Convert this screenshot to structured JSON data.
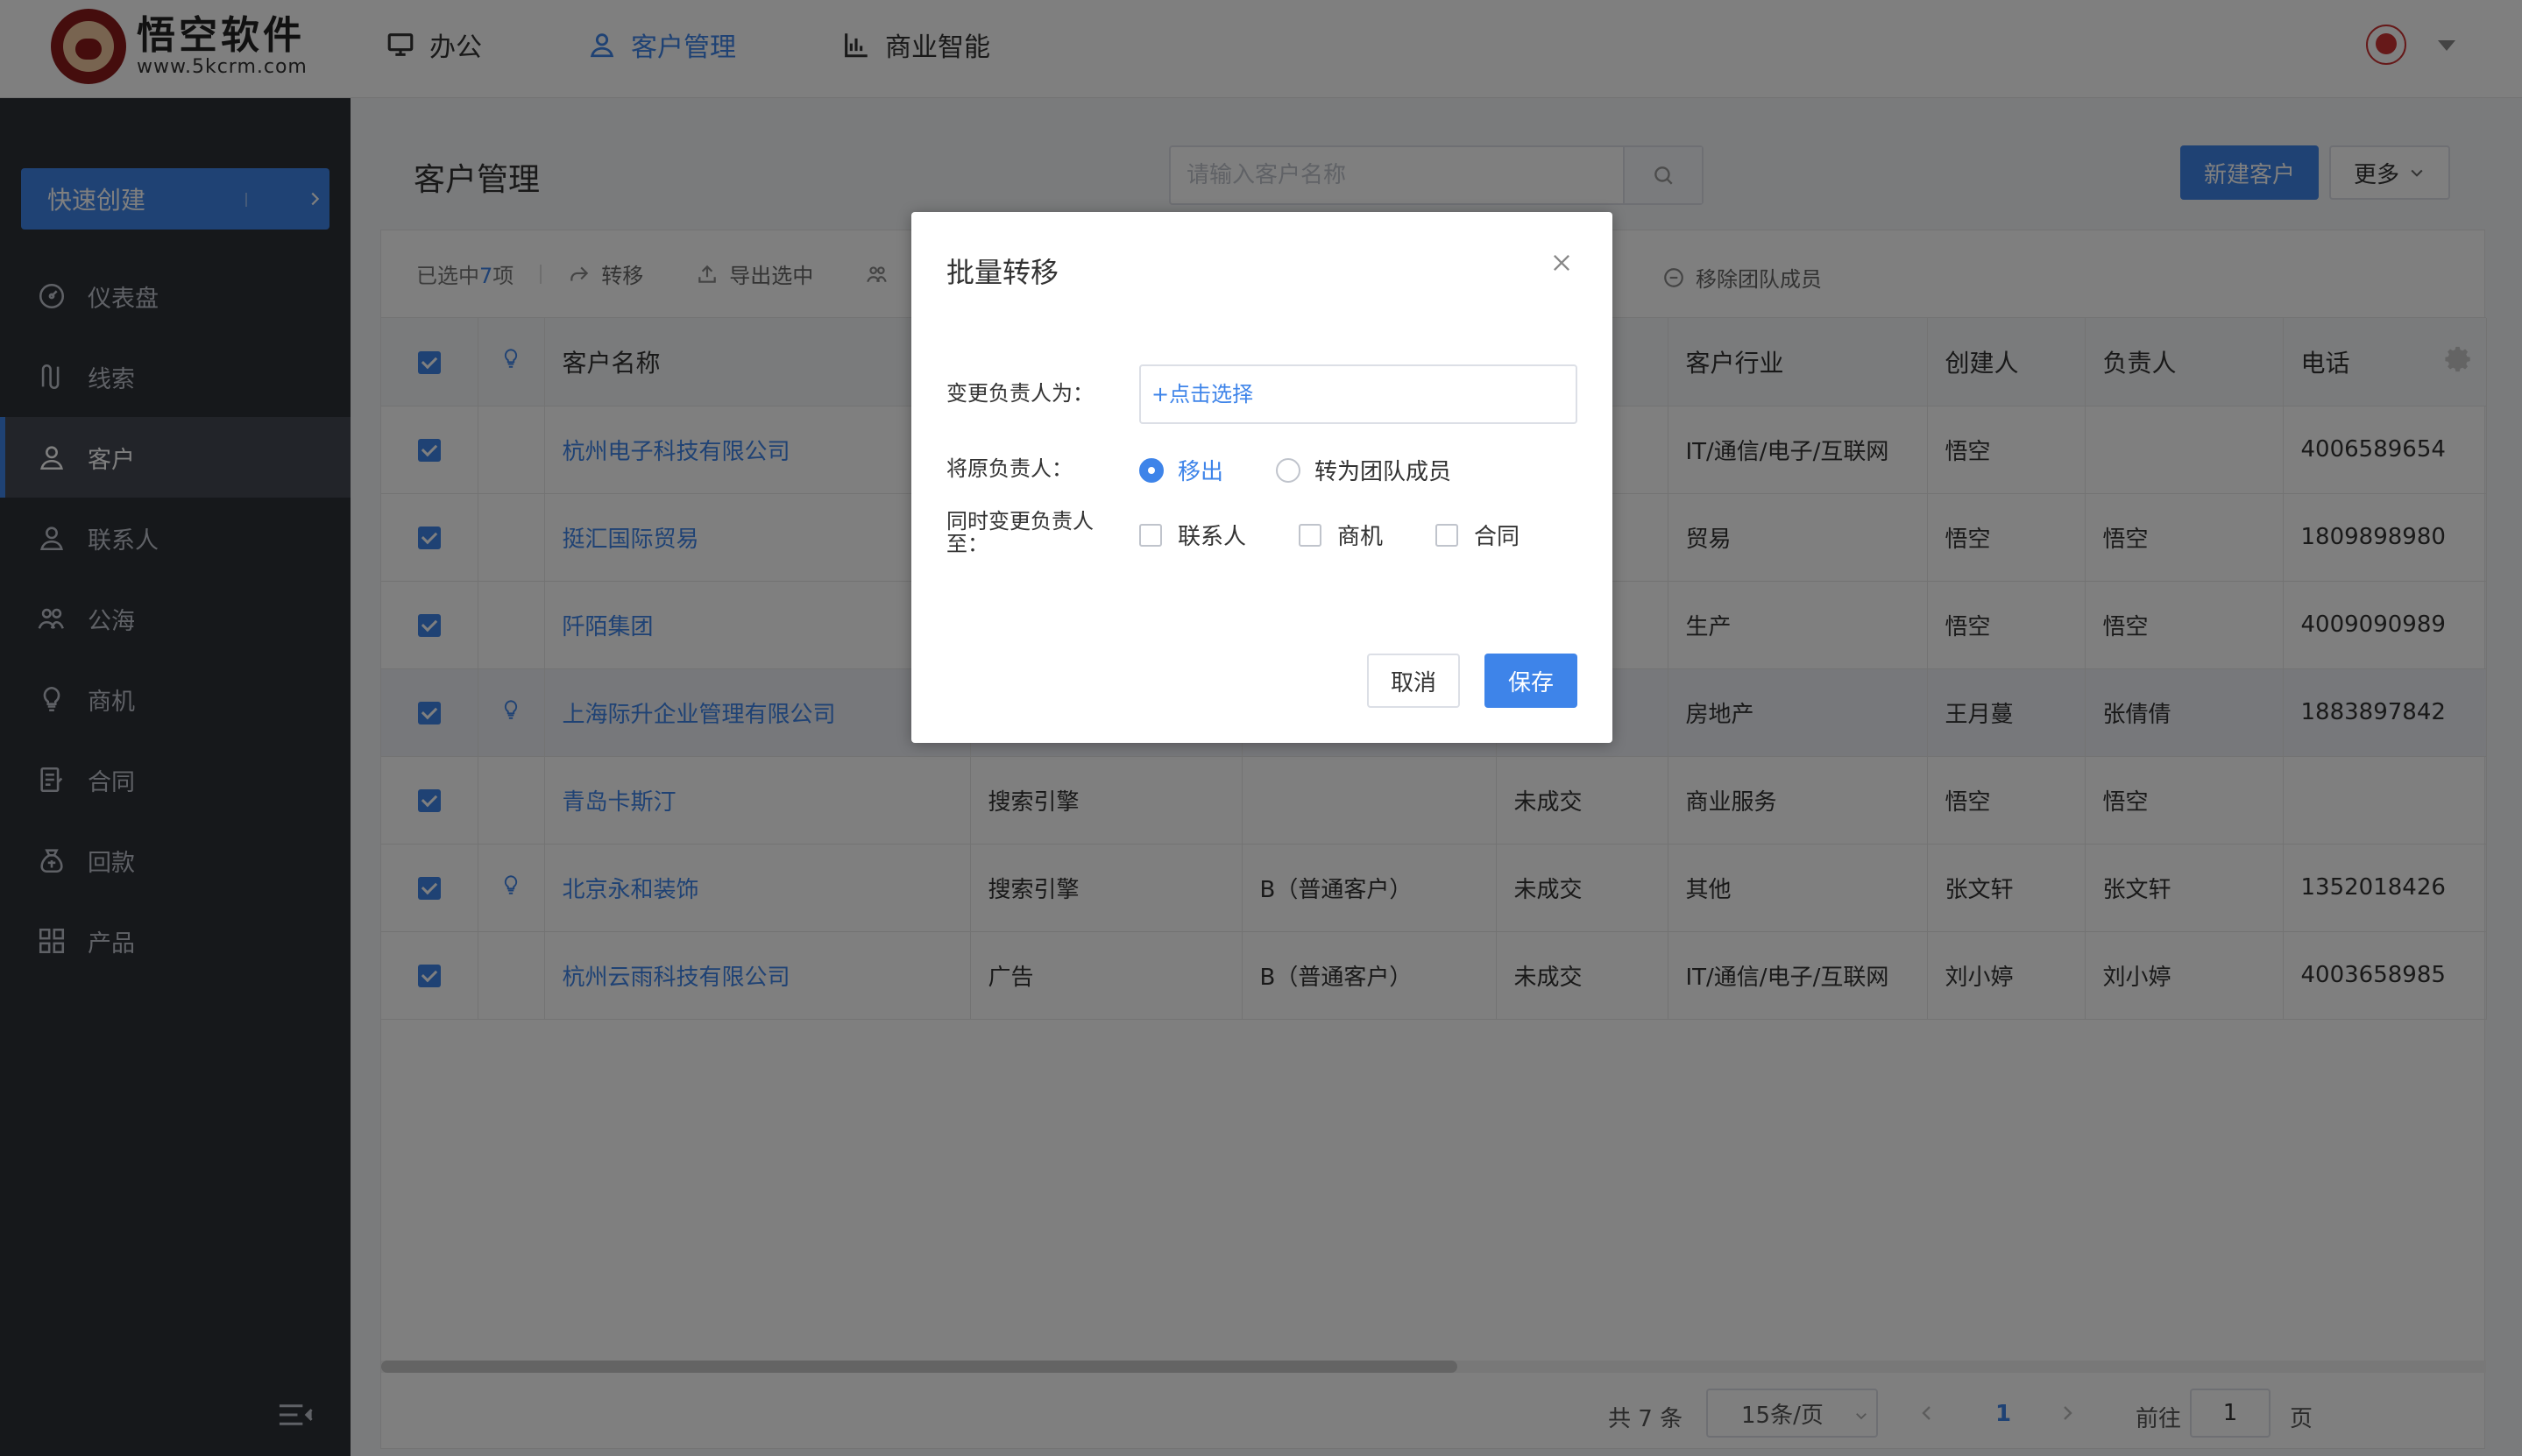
{
  "brand": {
    "title": "悟空软件",
    "subtitle": "www.5kcrm.com"
  },
  "topnav": [
    {
      "label": "办公",
      "icon": "monitor-icon"
    },
    {
      "label": "客户管理",
      "icon": "user-icon",
      "active": true
    },
    {
      "label": "商业智能",
      "icon": "bar-chart-icon"
    }
  ],
  "sidebar": {
    "quick_create": "快速创建",
    "items": [
      {
        "label": "仪表盘",
        "icon": "dashboard-icon"
      },
      {
        "label": "线索",
        "icon": "leads-icon"
      },
      {
        "label": "客户",
        "icon": "customer-icon",
        "active": true
      },
      {
        "label": "联系人",
        "icon": "contact-icon"
      },
      {
        "label": "公海",
        "icon": "pool-icon"
      },
      {
        "label": "商机",
        "icon": "bulb-icon"
      },
      {
        "label": "合同",
        "icon": "contract-icon"
      },
      {
        "label": "回款",
        "icon": "payment-icon"
      },
      {
        "label": "产品",
        "icon": "product-icon"
      }
    ]
  },
  "main": {
    "page_title": "客户管理",
    "search_placeholder": "请输入客户名称",
    "new_button": "新建客户",
    "more_button": "更多"
  },
  "toolbar": {
    "selected_prefix": "已选中",
    "selected_count": "7",
    "selected_suffix": "项",
    "transfer": "转移",
    "export": "导出选中",
    "remove_team": "移除团队成员"
  },
  "table": {
    "headers": {
      "name": "客户名称",
      "industry": "客户行业",
      "creator": "创建人",
      "owner": "负责人",
      "phone": "电话"
    },
    "rows": [
      {
        "name": "杭州电子科技有限公司",
        "source": "",
        "level": "",
        "status": "",
        "industry": "IT/通信/电子/互联网",
        "creator": "悟空",
        "owner": "",
        "phone": "4006589654",
        "bulb": false,
        "highlight": false
      },
      {
        "name": "挺汇国际贸易",
        "source": "",
        "level": "",
        "status": "",
        "industry": "贸易",
        "creator": "悟空",
        "owner": "悟空",
        "phone": "1809898980",
        "bulb": false,
        "highlight": false
      },
      {
        "name": "阡陌集团",
        "source": "",
        "level": "",
        "status": "",
        "industry": "生产",
        "creator": "悟空",
        "owner": "悟空",
        "phone": "4009090989",
        "bulb": false,
        "highlight": false
      },
      {
        "name": "上海际升企业管理有限公司",
        "source": "",
        "level": "",
        "status": "",
        "industry": "房地产",
        "creator": "王月蔓",
        "owner": "张倩倩",
        "phone": "1883897842",
        "bulb": true,
        "highlight": true
      },
      {
        "name": "青岛卡斯汀",
        "source": "搜索引擎",
        "level": "",
        "status": "未成交",
        "industry": "商业服务",
        "creator": "悟空",
        "owner": "悟空",
        "phone": "",
        "bulb": false,
        "highlight": false
      },
      {
        "name": "北京永和装饰",
        "source": "搜索引擎",
        "level": "B（普通客户）",
        "status": "未成交",
        "industry": "其他",
        "creator": "张文轩",
        "owner": "张文轩",
        "phone": "1352018426",
        "bulb": true,
        "highlight": false
      },
      {
        "name": "杭州云雨科技有限公司",
        "source": "广告",
        "level": "B（普通客户）",
        "status": "未成交",
        "industry": "IT/通信/电子/互联网",
        "creator": "刘小婷",
        "owner": "刘小婷",
        "phone": "4003658985",
        "bulb": false,
        "highlight": false
      }
    ]
  },
  "pager": {
    "total": "共 7 条",
    "page_size": "15条/页",
    "current_page": "1",
    "goto_label": "前往",
    "goto_value": "1",
    "goto_suffix": "页"
  },
  "dialog": {
    "title": "批量转移",
    "owner_label": "变更负责人为：",
    "owner_placeholder": "+点击选择",
    "original_label": "将原负责人：",
    "option_remove": "移出",
    "option_team": "转为团队成员",
    "also_label": "同时变更负责人至：",
    "chk_contact": "联系人",
    "chk_opportunity": "商机",
    "chk_contract": "合同",
    "cancel": "取消",
    "save": "保存"
  },
  "colors": {
    "accent": "#3e84e9",
    "sidebar_bg": "#2d3037",
    "overlay": "rgba(0,0,0,0.5)"
  }
}
